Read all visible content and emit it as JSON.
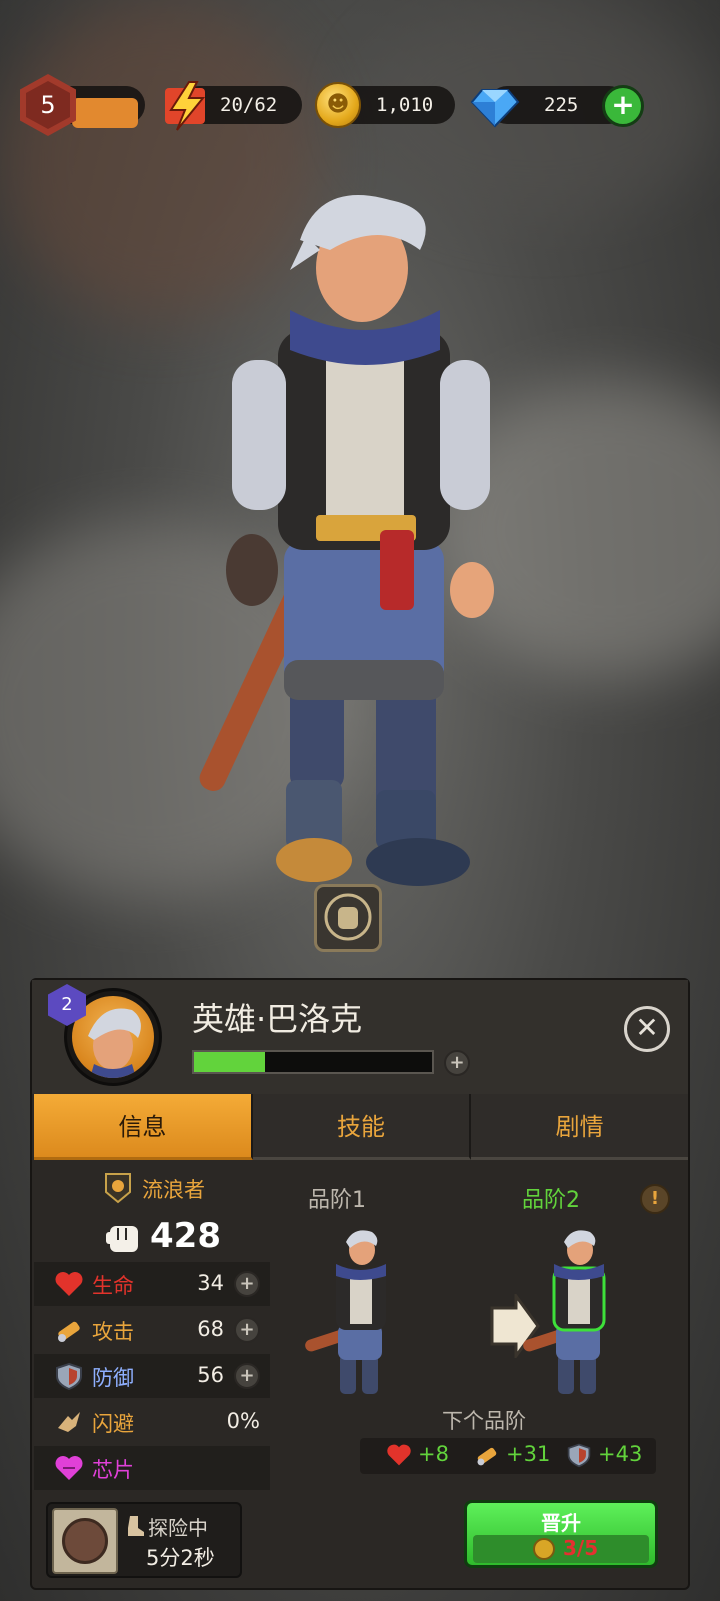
{
  "hud": {
    "level": "5",
    "energy": "20/62",
    "coins": "1,010",
    "gems": "225"
  },
  "hero": {
    "name": "英雄·巴洛克",
    "star_level": "2",
    "hp_progress": 0.3
  },
  "tabs": [
    {
      "label": "信息",
      "active": true
    },
    {
      "label": "技能",
      "active": false
    },
    {
      "label": "剧情",
      "active": false
    }
  ],
  "stats": {
    "class_name": "流浪者",
    "power": "428",
    "rows": [
      {
        "label": "生命",
        "value": "34",
        "color": "#e2332b",
        "icon": "heart-icon"
      },
      {
        "label": "攻击",
        "value": "68",
        "color": "#e9a53c",
        "icon": "attack-icon"
      },
      {
        "label": "防御",
        "value": "56",
        "color": "#8fb0ff",
        "icon": "shield-icon"
      },
      {
        "label": "闪避",
        "value": "0%",
        "color": "#e9a53c",
        "icon": "dodge-icon"
      },
      {
        "label": "芯片",
        "value": "",
        "color": "#e040d8",
        "icon": "chip-icon"
      }
    ]
  },
  "grade": {
    "current": "品阶1",
    "next": "品阶2",
    "next_label": "下个品阶",
    "bonuses": [
      {
        "icon": "heart-icon",
        "value": "+8"
      },
      {
        "icon": "attack-icon",
        "value": "+31"
      },
      {
        "icon": "shield-icon",
        "value": "+43"
      }
    ]
  },
  "explore": {
    "state": "探险中",
    "time": "5分2秒"
  },
  "promote": {
    "label": "晋升",
    "progress": "3/5"
  }
}
